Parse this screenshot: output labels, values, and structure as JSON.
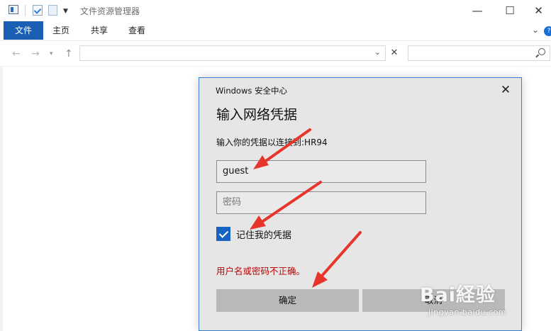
{
  "window": {
    "title": "文件资源管理器",
    "controls": {
      "minimize": "—",
      "maximize": "☐",
      "close": "✕"
    }
  },
  "ribbon": {
    "tabs": [
      "文件",
      "主页",
      "共享",
      "查看"
    ],
    "expand_glyph": "⌄",
    "help_glyph": "?"
  },
  "nav": {
    "back": "←",
    "forward": "→",
    "recent": "▾",
    "up": "↑",
    "address": "",
    "address_dropdown": "⌄",
    "clear": "✕",
    "search_placeholder": ""
  },
  "dialog": {
    "source": "Windows 安全中心",
    "close_glyph": "✕",
    "title": "输入网络凭据",
    "prompt": "输入你的凭据以连接到:HR94",
    "username_value": "guest",
    "password_placeholder": "密码",
    "remember_label": "记住我的凭据",
    "remember_checked": true,
    "error_message": "用户名或密码不正确。",
    "ok_label": "确定",
    "cancel_label": "取消"
  },
  "watermark": {
    "brand": "Bai経验",
    "url": "jingyan.baidu.com"
  },
  "colors": {
    "accent": "#1a5fb4",
    "error": "#c00000",
    "annotation": "#e8352c"
  }
}
